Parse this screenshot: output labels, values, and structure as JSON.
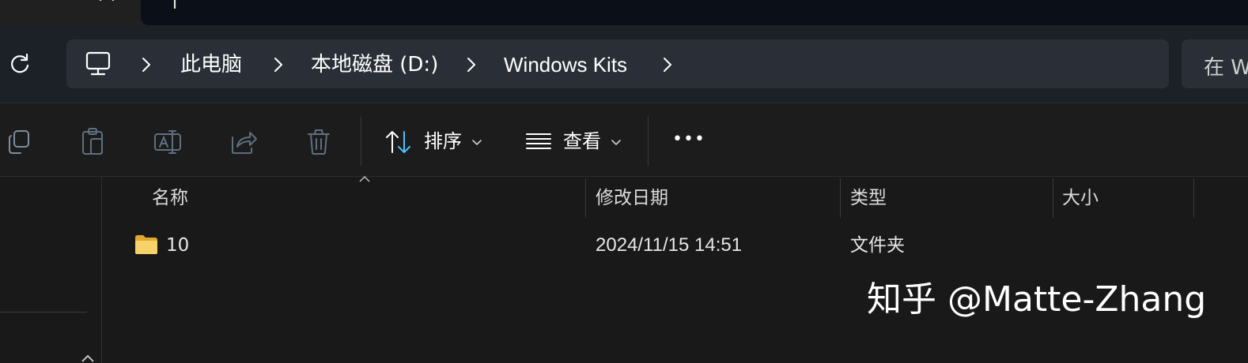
{
  "tabs": {
    "close_symbol": "×",
    "add_symbol": "+"
  },
  "address_bar": {
    "icon": "pc-icon",
    "breadcrumbs": [
      "此电脑",
      "本地磁盘 (D:)",
      "Windows Kits"
    ],
    "refresh_icon": "refresh-icon"
  },
  "search": {
    "placeholder": "在 W"
  },
  "toolbar": {
    "icons": [
      "copy-icon",
      "paste-icon",
      "rename-icon",
      "share-icon",
      "delete-icon"
    ],
    "sort_label": "排序",
    "view_label": "查看",
    "more_label": "•••"
  },
  "columns": {
    "name": "名称",
    "modified": "修改日期",
    "type": "类型",
    "size": "大小"
  },
  "rows": [
    {
      "name": "10",
      "modified": "2024/11/15 14:51",
      "type": "文件夹",
      "size": ""
    }
  ],
  "watermark": "知乎 @Matte-Zhang",
  "colors": {
    "background": "#191919",
    "toolbar": "#1c1c1c",
    "address_bg": "#2a2f37",
    "folder": "#f2c94c",
    "accent": "#4cc2ff"
  }
}
